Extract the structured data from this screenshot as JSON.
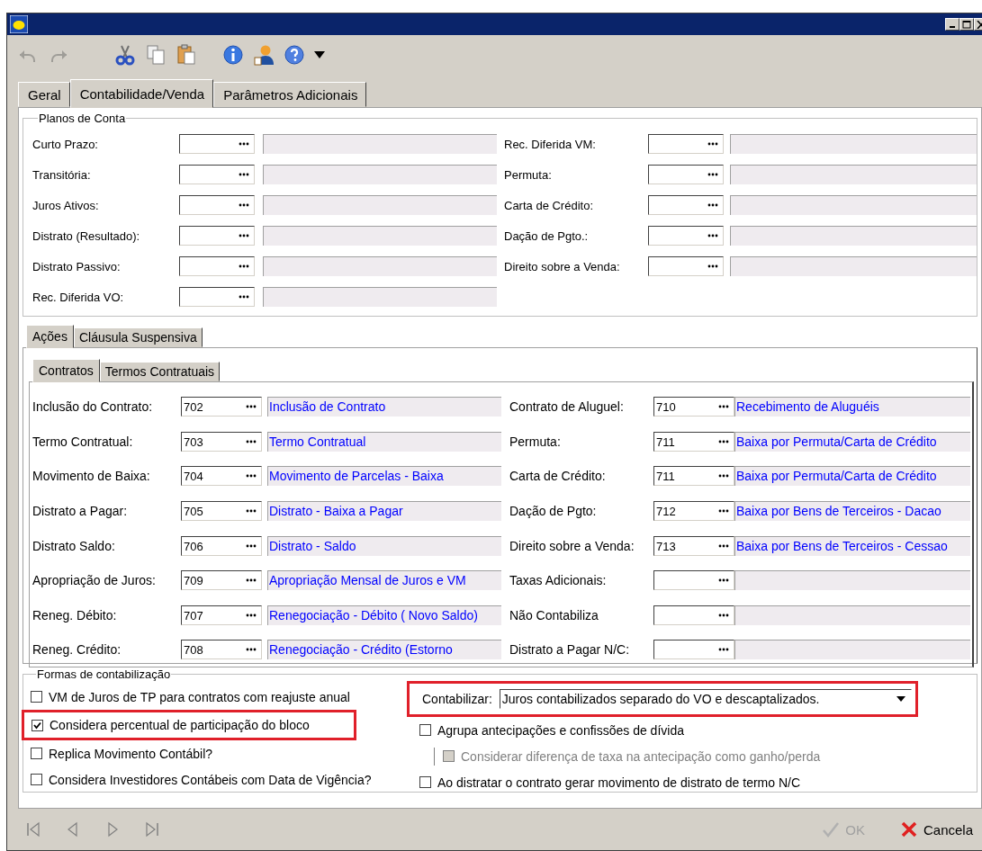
{
  "toolbar": [
    {
      "kind": "undo",
      "disabled": true
    },
    {
      "kind": "redo",
      "disabled": true
    },
    {
      "kind": "cut",
      "disabled": false
    },
    {
      "kind": "copy",
      "disabled": false
    },
    {
      "kind": "paste",
      "disabled": false
    },
    {
      "kind": "info",
      "disabled": false
    },
    {
      "kind": "user",
      "disabled": false
    },
    {
      "kind": "help",
      "disabled": false
    },
    {
      "kind": "caret",
      "disabled": false
    }
  ],
  "tabs": [
    {
      "label": "Geral",
      "selected": false
    },
    {
      "label": "Contabilidade/Venda",
      "selected": true
    },
    {
      "label": "Parâmetros Adicionais",
      "selected": false
    }
  ],
  "planos": {
    "title": "Planos de Conta",
    "left": [
      {
        "label": "Curto Prazo:"
      },
      {
        "label": "Transitória:"
      },
      {
        "label": "Juros Ativos:"
      },
      {
        "label": "Distrato (Resultado):"
      },
      {
        "label": "Distrato Passivo:"
      },
      {
        "label": "Rec. Diferida VO:"
      }
    ],
    "right": [
      {
        "label": "Rec. Diferida VM:"
      },
      {
        "label": "Permuta:"
      },
      {
        "label": "Carta de Crédito:"
      },
      {
        "label": "Dação de Pgto.:"
      },
      {
        "label": "Direito sobre a Venda:"
      }
    ]
  },
  "sub_tabs": [
    {
      "label": "Ações",
      "selected": true
    },
    {
      "label": "Cláusula Suspensiva",
      "selected": false
    }
  ],
  "inner_tabs": [
    {
      "label": "Contratos",
      "selected": true
    },
    {
      "label": "Termos Contratuais",
      "selected": false
    }
  ],
  "contratos": {
    "left": [
      {
        "label": "Inclusão do Contrato:",
        "code": "702",
        "description": "Inclusão de Contrato"
      },
      {
        "label": "Termo Contratual:",
        "code": "703",
        "description": "Termo Contratual"
      },
      {
        "label": "Movimento de Baixa:",
        "code": "704",
        "description": "Movimento de Parcelas - Baixa"
      },
      {
        "label": "Distrato a Pagar:",
        "code": "705",
        "description": "Distrato - Baixa a Pagar"
      },
      {
        "label": "Distrato Saldo:",
        "code": "706",
        "description": "Distrato - Saldo"
      },
      {
        "label": "Apropriação de Juros:",
        "code": "709",
        "description": "Apropriação Mensal de Juros e VM"
      },
      {
        "label": "Reneg. Débito:",
        "code": "707",
        "description": "Renegociação - Débito ( Novo Saldo)"
      },
      {
        "label": "Reneg. Crédito:",
        "code": "708",
        "description": "Renegociação - Crédito (Estorno"
      }
    ],
    "right": [
      {
        "label": "Contrato de Aluguel:",
        "code": "710",
        "description": "Recebimento de Aluguéis"
      },
      {
        "label": "Permuta:",
        "code": "711",
        "description": "Baixa por Permuta/Carta de Crédito"
      },
      {
        "label": "Carta de Crédito:",
        "code": "711",
        "description": "Baixa por Permuta/Carta de Crédito"
      },
      {
        "label": "Dação de Pgto:",
        "code": "712",
        "description": "Baixa por Bens de Terceiros - Dacao"
      },
      {
        "label": "Direito sobre a Venda:",
        "code": "713",
        "description": "Baixa por Bens de Terceiros - Cessao"
      },
      {
        "label": "Taxas Adicionais:"
      },
      {
        "label": "Não Contabiliza"
      },
      {
        "label": "Distrato a Pagar N/C:"
      }
    ]
  },
  "formas": {
    "title": "Formas de contabilização",
    "left_options": [
      {
        "label": "VM de Juros de TP para contratos com reajuste anual",
        "checked": false,
        "disabled": false,
        "highlighted": false
      },
      {
        "label": "Considera percentual de participação do bloco",
        "checked": true,
        "disabled": false,
        "highlighted": true
      },
      {
        "label": "Replica Movimento Contábil?",
        "checked": false,
        "disabled": false,
        "highlighted": false
      },
      {
        "label": "Considera Investidores Contábeis com Data de Vigência?",
        "checked": false,
        "disabled": false,
        "highlighted": false
      }
    ],
    "contabilizar": {
      "label": "Contabilizar:",
      "value": "Juros contabilizados separado do VO e descaptalizados.",
      "highlighted": true
    },
    "right_options": [
      {
        "label": "Agrupa antecipações e confissões de dívida",
        "checked": false,
        "disabled": false,
        "highlighted": false,
        "children": [
          {
            "label": "Considerar diferença de taxa na antecipação como ganho/perda",
            "checked": false,
            "disabled": true,
            "highlighted": false
          }
        ]
      },
      {
        "label": "Ao distratar o contrato gerar movimento de distrato de termo N/C",
        "checked": false,
        "disabled": false,
        "highlighted": false
      }
    ]
  },
  "navigation": [
    {
      "kind": "first"
    },
    {
      "kind": "previous"
    },
    {
      "kind": "next"
    },
    {
      "kind": "last"
    }
  ],
  "buttons": [
    {
      "kind": "ok",
      "label": "OK",
      "disabled": true
    },
    {
      "kind": "cancel",
      "label": "Cancela",
      "disabled": false
    }
  ]
}
